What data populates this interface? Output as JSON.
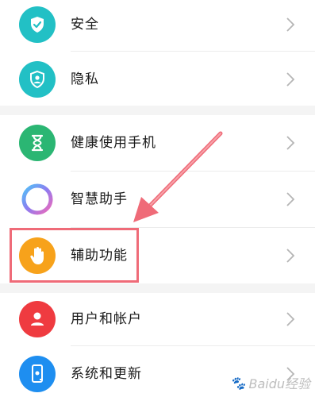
{
  "menu": {
    "items": [
      {
        "label": "安全",
        "icon": "shield-check-icon",
        "color": "#22c0c5"
      },
      {
        "label": "隐私",
        "icon": "shield-person-icon",
        "color": "#22c0c5"
      },
      {
        "label": "健康使用手机",
        "icon": "hourglass-icon",
        "color": "#2bb673"
      },
      {
        "label": "智慧助手",
        "icon": "assistant-ring-icon",
        "color": "#8f7bf0"
      },
      {
        "label": "辅助功能",
        "icon": "hand-icon",
        "color": "#f7a21b"
      },
      {
        "label": "用户和帐户",
        "icon": "user-icon",
        "color": "#ef3b40"
      },
      {
        "label": "系统和更新",
        "icon": "phone-update-icon",
        "color": "#1e8ef0"
      }
    ]
  },
  "annotation": {
    "highlight_color": "#ef6b78"
  },
  "watermark": {
    "text": "Baidu经验"
  }
}
